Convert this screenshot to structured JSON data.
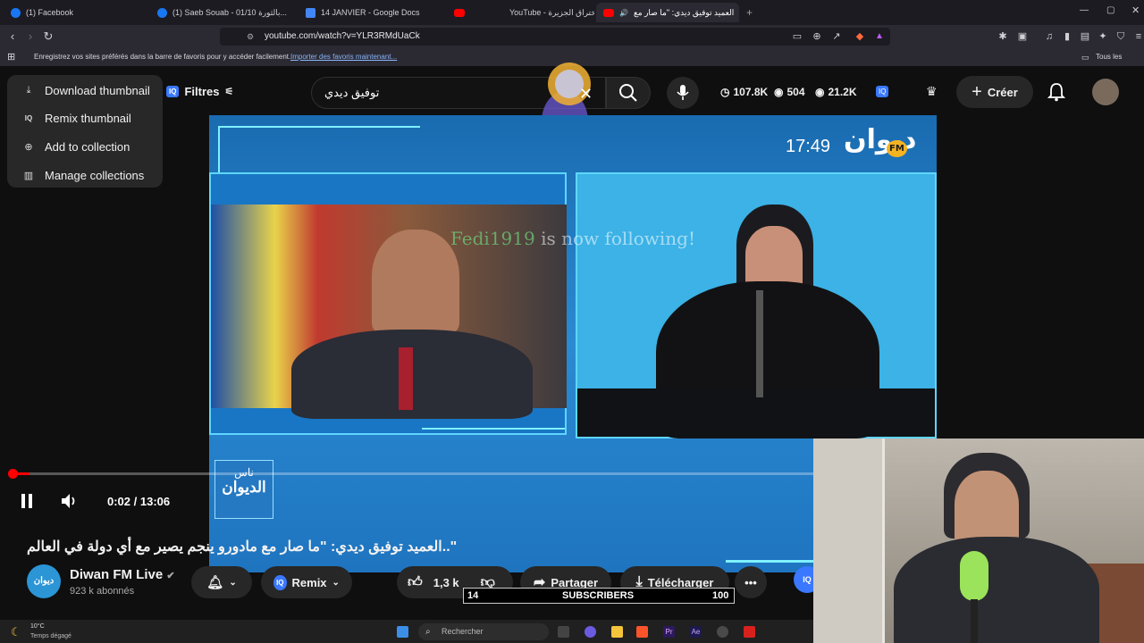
{
  "browser": {
    "tabs": [
      {
        "label": "(1) Facebook",
        "icon": "facebook-icon"
      },
      {
        "label": "(1) Saeb Souab - 01/10 بالثورة...",
        "icon": "facebook-icon"
      },
      {
        "label": "14 JANVIER - Google Docs",
        "icon": "google-docs-icon"
      },
      {
        "label": "YouTube - الاختراق الجزيرة",
        "icon": "youtube-icon"
      },
      {
        "label": "العميد توفيق ديدي: \"ما صار مع",
        "icon": "youtube-icon",
        "active": true
      }
    ],
    "url": "youtube.com/watch?v=YLR3RMdUaCk",
    "bookmarks_text": "Enregistrez vos sites préférés dans la barre de favoris pour y accéder facilement.",
    "bookmarks_link": "Importer des favoris maintenant...",
    "all_favorites": "Tous les favoris"
  },
  "youtube": {
    "menu": [
      {
        "label": "Download thumbnail",
        "icon": "download-icon"
      },
      {
        "label": "Remix thumbnail",
        "icon": "iq-icon"
      },
      {
        "label": "Add to collection",
        "icon": "collection-add-icon"
      },
      {
        "label": "Manage collections",
        "icon": "library-icon"
      }
    ],
    "filters_label": "Filtres",
    "search_value": "توفيق ديدي",
    "stats": {
      "views": "107.8K",
      "watching": "504",
      "eye": "21.2K"
    },
    "create_label": "Créer",
    "video": {
      "clock": "17:49",
      "logo": "ديوان",
      "logo_fm": "FM",
      "watermark_top": "ناس",
      "watermark_bottom": "الديوان",
      "follow_user": "Fedi1919",
      "follow_text": " is now following!"
    },
    "player": {
      "time": "0:02 / 13:06",
      "progress": 0.003
    },
    "title": "العميد توفيق ديدي: \"ما صار مع مادورو ينجم يصير مع أي دولة في العالم..\"",
    "channel": {
      "name": "Diwan FM Live",
      "subscribers": "923 k abonnés",
      "avatar_text": "ديوان"
    },
    "remix_label": "Remix",
    "likes": "1,3 k",
    "share_label": "Partager",
    "download_label": "Télécharger",
    "sub_goal": {
      "current": "14",
      "label": "SUBSCRIBERS",
      "target": "100"
    }
  },
  "taskbar": {
    "weather_temp": "10°C",
    "weather_text": "Temps dégagé",
    "search_placeholder": "Rechercher"
  }
}
